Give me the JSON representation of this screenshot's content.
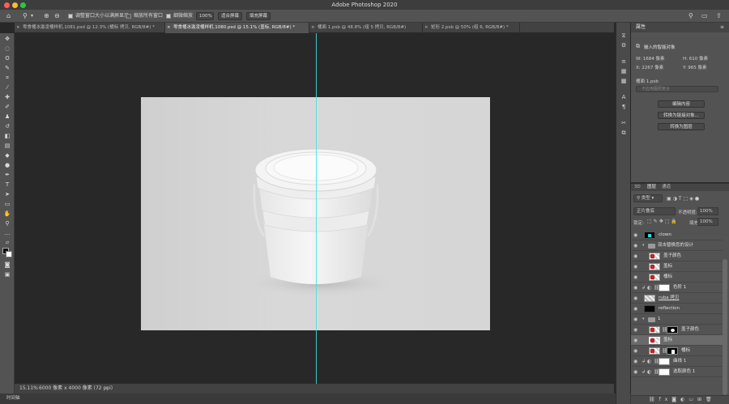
{
  "app": {
    "title": "Adobe Photoshop 2020"
  },
  "options": {
    "resize_windows": "调整窗口大小以满屏显示",
    "zoom_all": "缩放所有窗口",
    "scrubby_zoom": "细微缩放",
    "zoom_pct": "100%",
    "fit_screen": "适合屏幕",
    "fill_screen": "填充屏幕",
    "resize_checked": true,
    "zoom_all_checked": false,
    "scrubby_checked": true
  },
  "tabs": [
    {
      "label": "零食桶冰激凌桶样机.1081.psd @ 12.3% (桶标 拷贝, RGB/8#) *",
      "active": false
    },
    {
      "label": "零食桶冰激凌桶样机.1080.psd @ 15.1% (盖标, RGB/8#) *",
      "active": true
    },
    {
      "label": "桶面 1.psb @ 48.8% (组 5 拷贝, RGB/8#)",
      "active": false
    },
    {
      "label": "矩形 2.psb @ 50% (组 6, RGB/8#) *",
      "active": false
    }
  ],
  "status": {
    "zoom": "15.11%",
    "doc_info": "6000 像素 x 4000 像素 (72 ppi)"
  },
  "timeline": {
    "label": "时间轴"
  },
  "properties": {
    "tab": "属性",
    "type": "嵌入的智能对象",
    "w": "W: 1684 像素",
    "h": "H: 610 像素",
    "x": "X: 2267 像素",
    "y": "Y: 965 像素",
    "source": "桶面 1.psb",
    "layer_comp": "不应用图层复合",
    "buttons": [
      "编辑内容",
      "转换为链接对象...",
      "转换为图层"
    ]
  },
  "layers": {
    "tabs": [
      "3D",
      "图层",
      "通道"
    ],
    "kind": "类型",
    "blend": "正片叠底",
    "opacity_label": "不透明度:",
    "opacity": "100%",
    "lock_label": "锁定:",
    "fill_label": "填充:",
    "fill": "100%",
    "items": [
      {
        "name": "clown",
        "kind": "pixel",
        "indent": 0
      },
      {
        "name": "双击替换您的设计",
        "kind": "group",
        "indent": 0
      },
      {
        "name": "盖子颜色",
        "kind": "smart",
        "indent": 1
      },
      {
        "name": "盖标",
        "kind": "smart",
        "indent": 1
      },
      {
        "name": "桶标",
        "kind": "smart",
        "indent": 1
      },
      {
        "name": "色阶 1",
        "kind": "adjust",
        "indent": 0
      },
      {
        "name": "ruba 拷贝",
        "kind": "pixel",
        "indent": 0
      },
      {
        "name": "reflection",
        "kind": "dark",
        "indent": 0
      },
      {
        "name": "1",
        "kind": "group",
        "indent": 0
      },
      {
        "name": "盖子颜色",
        "kind": "mask",
        "indent": 1
      },
      {
        "name": "盖标",
        "kind": "smart",
        "indent": 1,
        "selected": true
      },
      {
        "name": "桶标",
        "kind": "mask",
        "indent": 1
      },
      {
        "name": "曲线 1",
        "kind": "adjust",
        "indent": 0
      },
      {
        "name": "选取颜色 1",
        "kind": "adjust",
        "indent": 0
      }
    ]
  }
}
